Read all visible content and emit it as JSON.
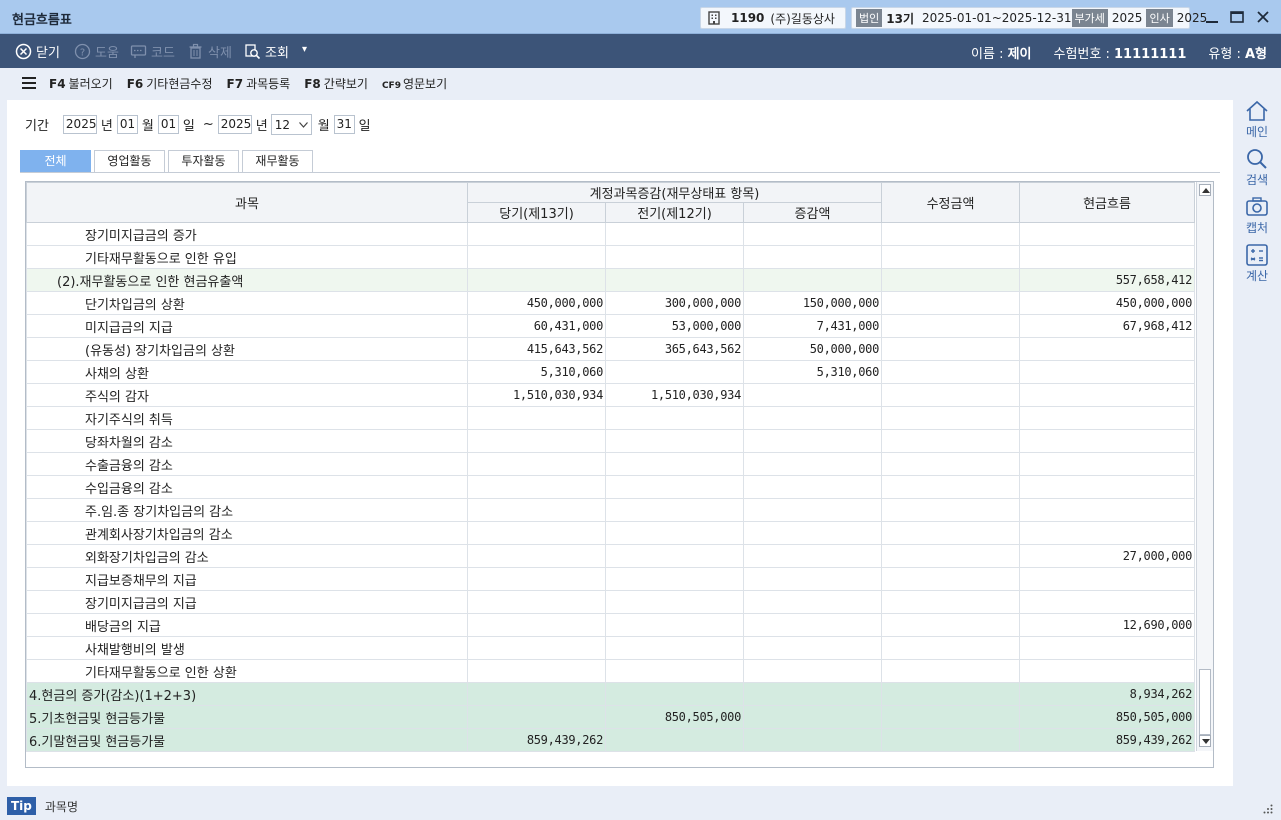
{
  "window": {
    "title": "현금흐름표",
    "company_code": "1190",
    "company_name": "(주)길동상사",
    "tag_corp": "법인",
    "fiscal_term": "13기",
    "fiscal_period": "2025-01-01~2025-12-31",
    "tag_vat": "부가세",
    "vat_year": "2025",
    "tag_hr": "인사",
    "hr_year": "2025"
  },
  "toolbar": {
    "close": "닫기",
    "help": "도움",
    "code": "코드",
    "delete": "삭제",
    "search": "조회",
    "user_name_label": "이름 : ",
    "user_name": "제이",
    "exam_no_label": "수험번호 : ",
    "exam_no": "11111111",
    "type_label": "유형 : ",
    "type_value": "A형"
  },
  "fkeys": [
    {
      "key": "F4",
      "label": "불러오기"
    },
    {
      "key": "F6",
      "label": "기타현금수정"
    },
    {
      "key": "F7",
      "label": "과목등록"
    },
    {
      "key": "F8",
      "label": "간략보기"
    },
    {
      "key": "CF9",
      "label": "영문보기"
    }
  ],
  "period": {
    "label": "기간",
    "from_year": "2025",
    "from_month": "01",
    "from_day": "01",
    "to_year": "2025",
    "to_month": "12",
    "to_day": "31",
    "year_unit": "년",
    "month_unit": "월",
    "day_unit": "일",
    "tilde": "~"
  },
  "tabs": [
    "전체",
    "영업활동",
    "투자활동",
    "재무활동"
  ],
  "grid": {
    "headers": {
      "account": "과목",
      "group": "계정과목증감(재무상태표 항목)",
      "current": "당기(제13기)",
      "prior": "전기(제12기)",
      "change": "증감액",
      "adjust": "수정금액",
      "cashflow": "현금흐름"
    },
    "rows": [
      {
        "kind": "item",
        "name": "장기미지급금의 증가",
        "current": "",
        "prior": "",
        "change": "",
        "adjust": "",
        "cashflow": ""
      },
      {
        "kind": "item",
        "name": "기타재무활동으로 인한 유입",
        "current": "",
        "prior": "",
        "change": "",
        "adjust": "",
        "cashflow": ""
      },
      {
        "kind": "sub",
        "name": "(2).재무활동으로 인한 현금유출액",
        "current": "",
        "prior": "",
        "change": "",
        "adjust": "",
        "cashflow": "557,658,412"
      },
      {
        "kind": "item",
        "name": "단기차입금의 상환",
        "current": "450,000,000",
        "prior": "300,000,000",
        "change": "150,000,000",
        "adjust": "",
        "cashflow": "450,000,000"
      },
      {
        "kind": "item",
        "name": "미지급금의 지급",
        "current": "60,431,000",
        "prior": "53,000,000",
        "change": "7,431,000",
        "adjust": "",
        "cashflow": "67,968,412"
      },
      {
        "kind": "item",
        "name": "(유동성) 장기차입금의 상환",
        "current": "415,643,562",
        "prior": "365,643,562",
        "change": "50,000,000",
        "adjust": "",
        "cashflow": ""
      },
      {
        "kind": "item",
        "name": "사채의 상환",
        "current": "5,310,060",
        "prior": "",
        "change": "5,310,060",
        "adjust": "",
        "cashflow": ""
      },
      {
        "kind": "item",
        "name": "주식의 감자",
        "current": "1,510,030,934",
        "prior": "1,510,030,934",
        "change": "",
        "adjust": "",
        "cashflow": ""
      },
      {
        "kind": "item",
        "name": "자기주식의  취득",
        "current": "",
        "prior": "",
        "change": "",
        "adjust": "",
        "cashflow": ""
      },
      {
        "kind": "item",
        "name": "당좌차월의 감소",
        "current": "",
        "prior": "",
        "change": "",
        "adjust": "",
        "cashflow": ""
      },
      {
        "kind": "item",
        "name": "수출금융의 감소",
        "current": "",
        "prior": "",
        "change": "",
        "adjust": "",
        "cashflow": ""
      },
      {
        "kind": "item",
        "name": "수입금융의 감소",
        "current": "",
        "prior": "",
        "change": "",
        "adjust": "",
        "cashflow": ""
      },
      {
        "kind": "item",
        "name": "주.임.종 장기차입금의 감소",
        "current": "",
        "prior": "",
        "change": "",
        "adjust": "",
        "cashflow": ""
      },
      {
        "kind": "item",
        "name": "관계회사장기차입금의 감소",
        "current": "",
        "prior": "",
        "change": "",
        "adjust": "",
        "cashflow": ""
      },
      {
        "kind": "item",
        "name": "외화장기차입금의 감소",
        "current": "",
        "prior": "",
        "change": "",
        "adjust": "",
        "cashflow": "27,000,000"
      },
      {
        "kind": "item",
        "name": "지급보증채무의 지급",
        "current": "",
        "prior": "",
        "change": "",
        "adjust": "",
        "cashflow": ""
      },
      {
        "kind": "item",
        "name": "장기미지급금의 지급",
        "current": "",
        "prior": "",
        "change": "",
        "adjust": "",
        "cashflow": ""
      },
      {
        "kind": "item",
        "name": "배당금의 지급",
        "current": "",
        "prior": "",
        "change": "",
        "adjust": "",
        "cashflow": "12,690,000"
      },
      {
        "kind": "item",
        "name": "사채발행비의 발생",
        "current": "",
        "prior": "",
        "change": "",
        "adjust": "",
        "cashflow": ""
      },
      {
        "kind": "item",
        "name": "기타재무활동으로 인한 상환",
        "current": "",
        "prior": "",
        "change": "",
        "adjust": "",
        "cashflow": ""
      },
      {
        "kind": "total",
        "name": "4.현금의 증가(감소)(1+2+3)",
        "current": "",
        "prior": "",
        "change": "",
        "adjust": "",
        "cashflow": "8,934,262"
      },
      {
        "kind": "total",
        "name": "5.기초현금및 현금등가물",
        "current": "",
        "prior": "850,505,000",
        "change": "",
        "adjust": "",
        "cashflow": "850,505,000"
      },
      {
        "kind": "total",
        "name": "6.기말현금및 현금등가물",
        "current": "859,439,262",
        "prior": "",
        "change": "",
        "adjust": "",
        "cashflow": "859,439,262"
      }
    ]
  },
  "side": [
    "메인",
    "검색",
    "캡처",
    "계산"
  ],
  "status": {
    "tip": "Tip",
    "text": "과목명"
  },
  "colors": {
    "titlebar": "#a9c9ee",
    "toolbar": "#3c5478",
    "active_tab": "#7fb2ee",
    "total_row": "#d4ebe0",
    "sub_row": "#eff7ef"
  }
}
